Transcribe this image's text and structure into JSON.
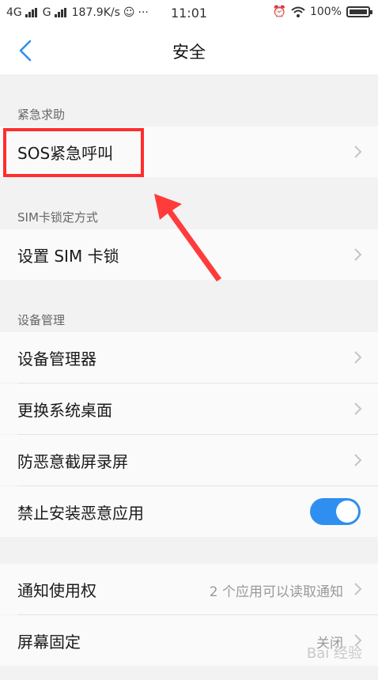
{
  "status_bar": {
    "network1": "4G",
    "network2": "G",
    "speed": "187.9K/s",
    "dots": "···",
    "time": "11:01",
    "battery": "100%"
  },
  "header": {
    "title": "安全"
  },
  "sections": {
    "emergency": {
      "label": "紧急求助",
      "items": [
        {
          "label": "SOS紧急呼叫"
        }
      ]
    },
    "sim": {
      "label": "SIM卡锁定方式",
      "items": [
        {
          "label": "设置 SIM 卡锁"
        }
      ]
    },
    "device": {
      "label": "设备管理",
      "items": [
        {
          "label": "设备管理器"
        },
        {
          "label": "更换系统桌面"
        },
        {
          "label": "防恶意截屏录屏"
        },
        {
          "label": "禁止安装恶意应用",
          "toggle_on": true
        }
      ]
    },
    "other": {
      "items": [
        {
          "label": "通知使用权",
          "value": "2 个应用可以读取通知"
        },
        {
          "label": "屏幕固定",
          "value": "关闭"
        }
      ]
    }
  },
  "watermark": "Bai 经验",
  "colors": {
    "accent": "#2f8ff0",
    "highlight": "#ff2d2d"
  }
}
